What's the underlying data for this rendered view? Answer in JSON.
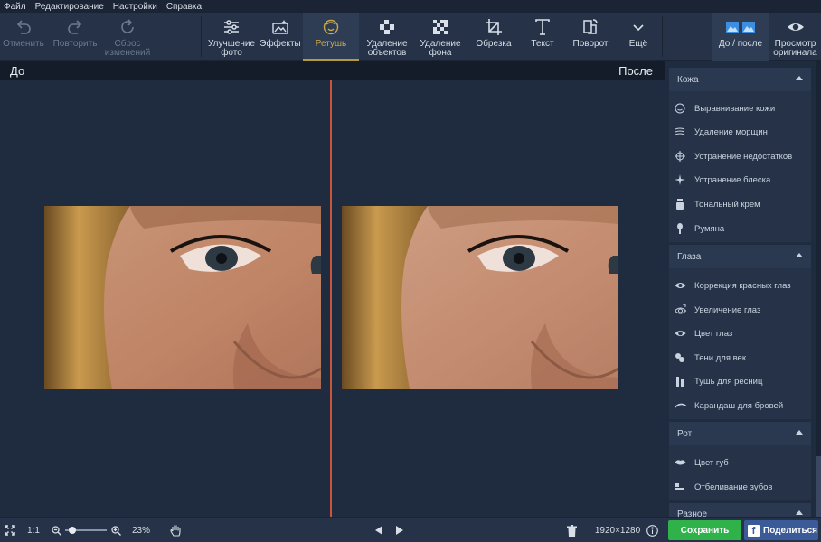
{
  "menu": [
    "Файл",
    "Редактирование",
    "Настройки",
    "Справка"
  ],
  "toolbar": {
    "undo": "Отменить",
    "redo": "Повторить",
    "reset": [
      "Сброс",
      "изменений"
    ],
    "enhance": [
      "Улучшение",
      "фото"
    ],
    "effects": "Эффекты",
    "retouch": "Ретушь",
    "remove_objects": [
      "Удаление",
      "объектов"
    ],
    "remove_bg": [
      "Удаление",
      "фона"
    ],
    "crop": "Обрезка",
    "text": "Текст",
    "rotate": "Поворот",
    "more": "Ещё",
    "before_after": "До / после",
    "view_original": [
      "Просмотр",
      "оригинала"
    ]
  },
  "compare": {
    "before": "До",
    "after": "После"
  },
  "panel": {
    "sections": [
      {
        "title": "Кожа",
        "items": [
          "Выравнивание кожи",
          "Удаление морщин",
          "Устранение недостатков",
          "Устранение блеска",
          "Тональный крем",
          "Румяна"
        ]
      },
      {
        "title": "Глаза",
        "items": [
          "Коррекция красных глаз",
          "Увеличение глаз",
          "Цвет глаз",
          "Тени для век",
          "Тушь для ресниц",
          "Карандаш для бровей"
        ]
      },
      {
        "title": "Рот",
        "items": [
          "Цвет губ",
          "Отбеливание зубов"
        ]
      },
      {
        "title": "Разное",
        "items": []
      }
    ]
  },
  "bottom": {
    "ratio": "1:1",
    "zoom": "23%",
    "zoom_level": 0.1,
    "dimensions": "1920×1280",
    "save": "Сохранить",
    "share": "Поделиться"
  },
  "colors": {
    "accent": "#c9a94a",
    "divider": "#c8563a",
    "save": "#2fb24a",
    "share": "#3b5a98"
  }
}
